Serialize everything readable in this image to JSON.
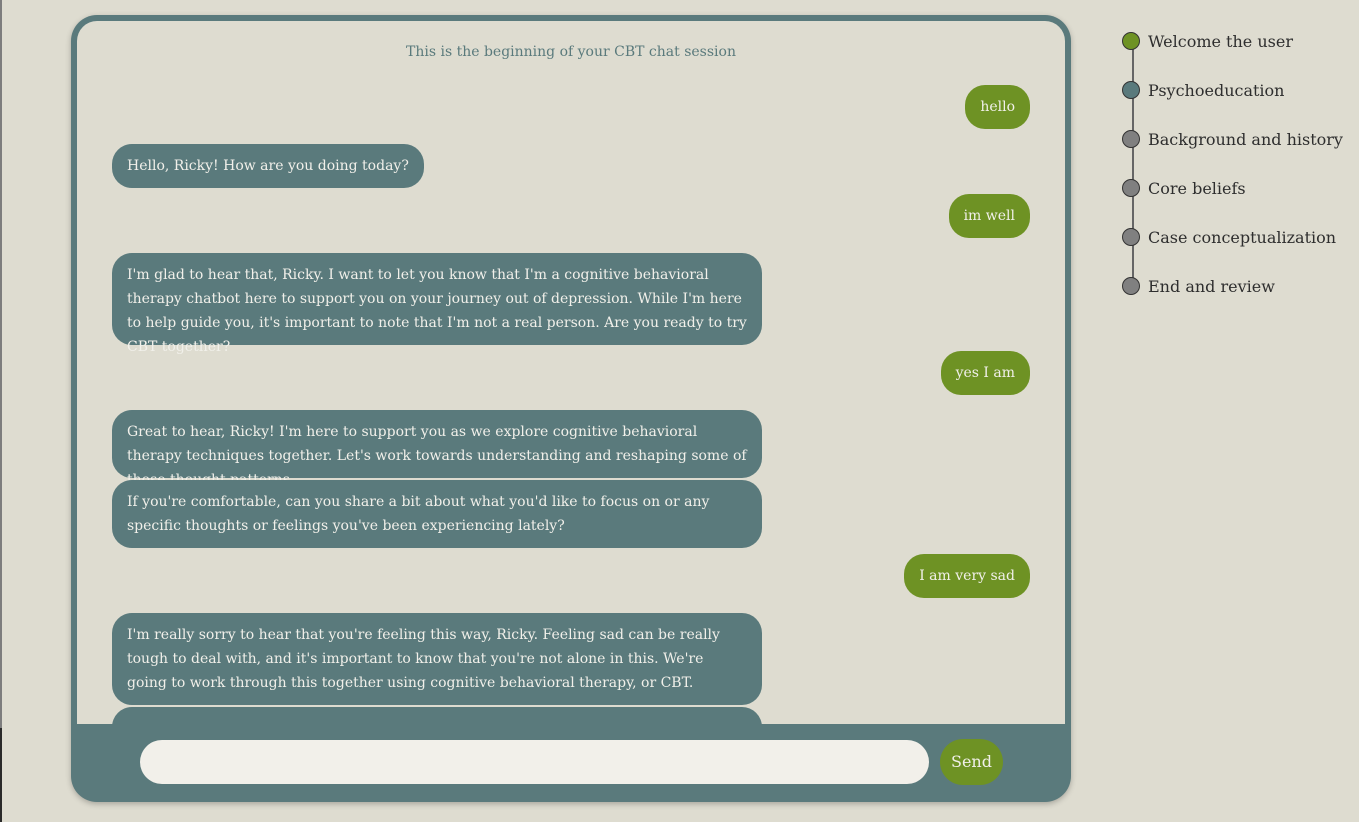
{
  "chat": {
    "session_note": "This is the beginning of your CBT chat session",
    "messages": [
      {
        "role": "user",
        "text": "hello"
      },
      {
        "role": "bot",
        "text": "Hello, Ricky! How are you doing today?"
      },
      {
        "role": "user",
        "text": "im well"
      },
      {
        "role": "bot",
        "text": "I'm glad to hear that, Ricky. I want to let you know that I'm a cognitive behavioral therapy chatbot here to support you on your journey out of depression. While I'm here to help guide you, it's important to note that I'm not a real person. Are you ready to try CBT together?"
      },
      {
        "role": "user",
        "text": "yes I am"
      },
      {
        "role": "bot",
        "text": "Great to hear, Ricky! I'm here to support you as we explore cognitive behavioral therapy techniques together. Let's work towards understanding and reshaping some of those thought patterns."
      },
      {
        "role": "bot",
        "text": "If you're comfortable, can you share a bit about what you'd like to focus on or any specific thoughts or feelings you've been experiencing lately?"
      },
      {
        "role": "user",
        "text": "I am very sad"
      },
      {
        "role": "bot",
        "text": "I'm really sorry to hear that you're feeling this way, Ricky. Feeling sad can be really tough to deal with, and it's important to know that you're not alone in this. We're going to work through this together using cognitive behavioral therapy, or CBT."
      },
      {
        "role": "bot",
        "text": ""
      }
    ]
  },
  "composer": {
    "input_value": "",
    "send_label": "Send"
  },
  "progress": {
    "steps": [
      {
        "label": "Welcome the user",
        "state": "done",
        "color": "#6e9224"
      },
      {
        "label": "Psychoeducation",
        "state": "current",
        "color": "#5a7a7c"
      },
      {
        "label": "Background and history",
        "state": "pending",
        "color": "#808080"
      },
      {
        "label": "Core beliefs",
        "state": "pending",
        "color": "#808080"
      },
      {
        "label": "Case conceptualization",
        "state": "pending",
        "color": "#808080"
      },
      {
        "label": "End and review",
        "state": "pending",
        "color": "#808080"
      }
    ]
  },
  "colors": {
    "background": "#dedcd0",
    "frame": "#5a7a7c",
    "accent_green": "#6e9224",
    "bot_bubble": "#5a7a7c",
    "user_bubble": "#6e9224"
  }
}
